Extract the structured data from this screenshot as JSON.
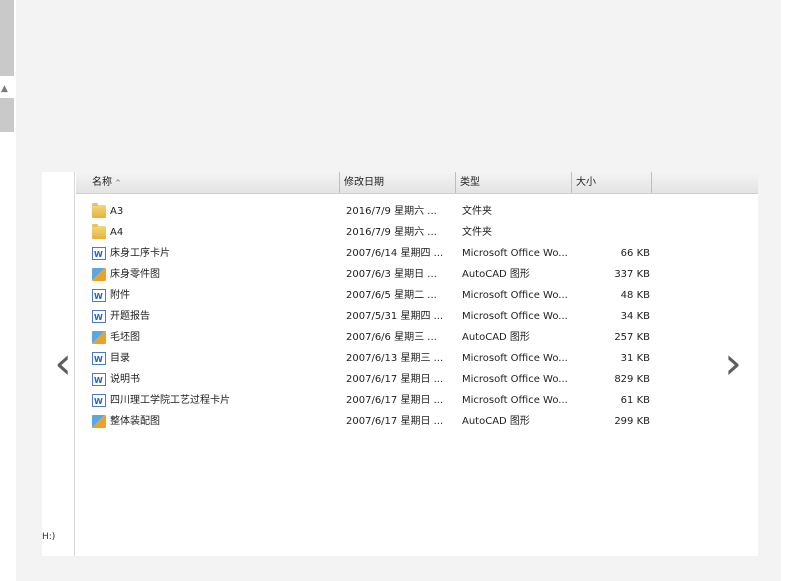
{
  "columns": {
    "name": "名称",
    "date": "修改日期",
    "type": "类型",
    "size": "大小"
  },
  "nav_pane": {
    "drive_label": "H:)"
  },
  "files": [
    {
      "name": "A3",
      "date": "2016/7/9 星期六 ...",
      "type": "文件夹",
      "size": "",
      "icon": "folder-icon"
    },
    {
      "name": "A4",
      "date": "2016/7/9 星期六 ...",
      "type": "文件夹",
      "size": "",
      "icon": "folder-icon"
    },
    {
      "name": "床身工序卡片",
      "date": "2007/6/14 星期四 ...",
      "type": "Microsoft Office Wo...",
      "size": "66 KB",
      "icon": "word-doc-icon"
    },
    {
      "name": "床身零件图",
      "date": "2007/6/3 星期日 ...",
      "type": "AutoCAD 图形",
      "size": "337 KB",
      "icon": "autocad-dwg-icon"
    },
    {
      "name": "附件",
      "date": "2007/6/5 星期二 ...",
      "type": "Microsoft Office Wo...",
      "size": "48 KB",
      "icon": "word-doc-icon"
    },
    {
      "name": "开题报告",
      "date": "2007/5/31 星期四 ...",
      "type": "Microsoft Office Wo...",
      "size": "34 KB",
      "icon": "word-doc-icon"
    },
    {
      "name": "毛坯图",
      "date": "2007/6/6 星期三 ...",
      "type": "AutoCAD 图形",
      "size": "257 KB",
      "icon": "autocad-dwg-icon"
    },
    {
      "name": "目录",
      "date": "2007/6/13 星期三 ...",
      "type": "Microsoft Office Wo...",
      "size": "31 KB",
      "icon": "word-doc-icon"
    },
    {
      "name": "说明书",
      "date": "2007/6/17 星期日 ...",
      "type": "Microsoft Office Wo...",
      "size": "829 KB",
      "icon": "word-doc-icon"
    },
    {
      "name": "四川理工学院工艺过程卡片",
      "date": "2007/6/17 星期日 ...",
      "type": "Microsoft Office Wo...",
      "size": "61 KB",
      "icon": "word-doc-icon"
    },
    {
      "name": "整体装配图",
      "date": "2007/6/17 星期日 ...",
      "type": "AutoCAD 图形",
      "size": "299 KB",
      "icon": "autocad-dwg-icon"
    }
  ],
  "gallery": {
    "prev_glyph": "‹",
    "next_glyph": "›"
  }
}
